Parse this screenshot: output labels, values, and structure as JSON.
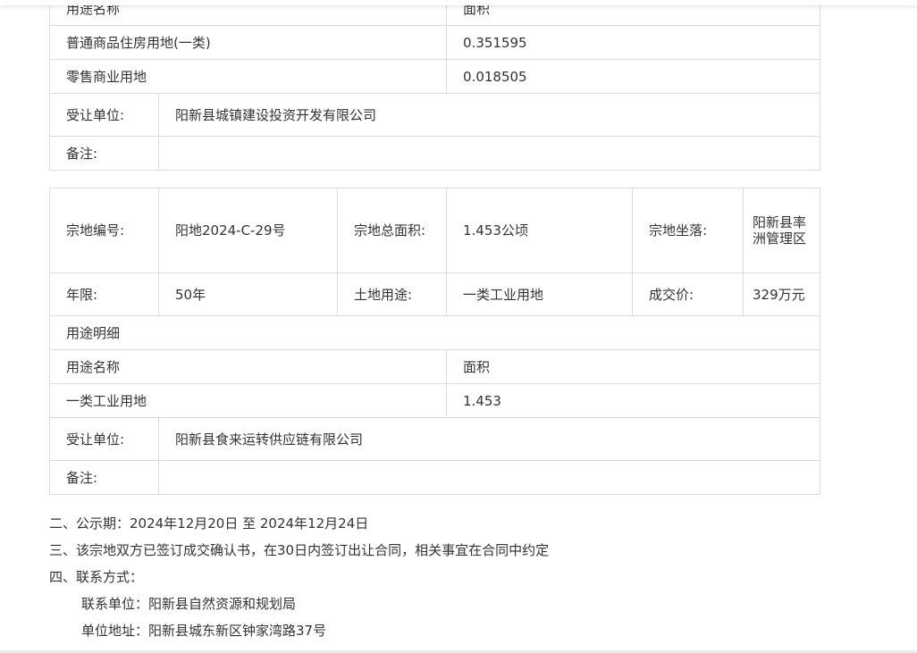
{
  "table1": {
    "usage_header": "用途名称",
    "area_header": "面积",
    "rows": [
      {
        "usage": "普通商品住房用地(一类)",
        "area": "0.351595"
      },
      {
        "usage": "零售商业用地",
        "area": "0.018505"
      }
    ],
    "transferee_label": "受让单位:",
    "transferee_value": "阳新县城镇建设投资开发有限公司",
    "remark_label": "备注:",
    "remark_value": ""
  },
  "table2": {
    "parcel_no_label": "宗地编号:",
    "parcel_no_value": "阳地2024-C-29号",
    "total_area_label": "宗地总面积:",
    "total_area_value": "1.453公顷",
    "location_label": "宗地坐落:",
    "location_value": "阳新县率洲管理区",
    "term_label": "年限:",
    "term_value": "50年",
    "land_use_label": "土地用途:",
    "land_use_value": "一类工业用地",
    "price_label": "成交价:",
    "price_value": "329万元",
    "usage_detail_title": "用途明细",
    "usage_header": "用途名称",
    "area_header": "面积",
    "rows": [
      {
        "usage": "一类工业用地",
        "area": "1.453"
      }
    ],
    "transferee_label": "受让单位:",
    "transferee_value": "阳新县食来运转供应链有限公司",
    "remark_label": "备注:",
    "remark_value": ""
  },
  "notes": {
    "publicity": "二、公示期：2024年12月20日 至 2024年12月24日",
    "contract": "三、该宗地双方已签订成交确认书，在30日内签订出让合同，相关事宜在合同中约定",
    "contact_title": "四、联系方式：",
    "contact_unit": "联系单位：阳新县自然资源和规划局",
    "contact_address": "单位地址：阳新县城东新区钟家湾路37号"
  }
}
